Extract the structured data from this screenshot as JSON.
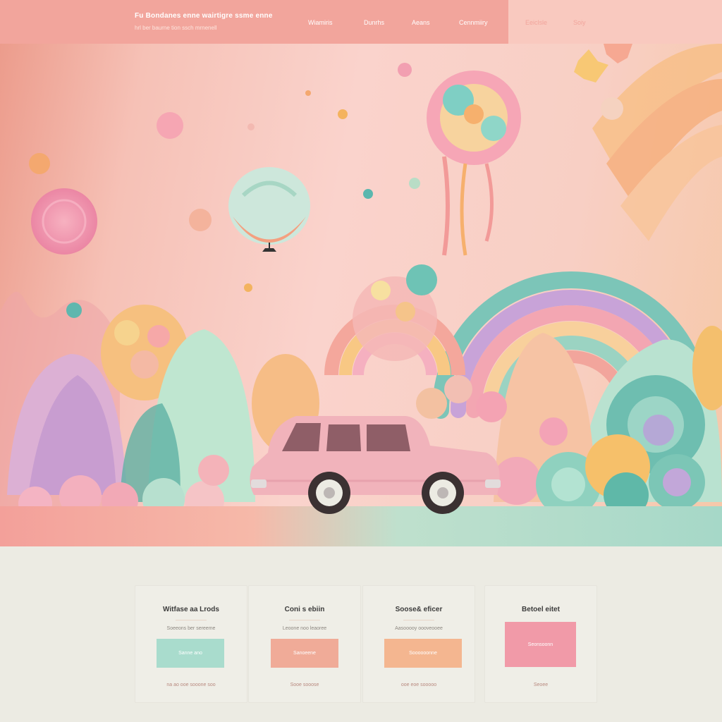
{
  "header": {
    "brand_title": "Fu Bondanes enne wairtigre ssme enne",
    "brand_subtitle": "hrl ber baurne tion ssch mrnenell",
    "nav": [
      "Wiamiris",
      "Dunrhs",
      "Aeans",
      "Cennmiiry"
    ],
    "nav_right": [
      "Eeiclsle",
      "Soiy"
    ],
    "colors": {
      "left": "#f2a59c",
      "right": "#f9c9bf"
    }
  },
  "hero": {
    "scene": "pastel candy landscape with pink car, rainbows, balloons"
  },
  "features": {
    "cards": [
      {
        "title": "Witfase aa Lrods",
        "subtitle": "Soeeons ber sereeme",
        "button": "Sanne ano",
        "footer": "na ao ooe sooone soo",
        "button_color": "#a9dccd"
      },
      {
        "title": "Coni s ebiin",
        "subtitle": "Leoone noo leaoree",
        "button": "Sanoeene",
        "footer": "Sooe sooose",
        "button_color": "#f0ab98"
      },
      {
        "title": "Soose& eficer",
        "subtitle": "Aasooooy oooveooee",
        "button": "Soooooonne",
        "footer": "ooe eoe sooooo",
        "button_color": "#f4b690"
      },
      {
        "title": "Betoel eitet",
        "subtitle": "",
        "button": "Seonsoonn",
        "footer": "Seoee",
        "button_color": "#f19aa8"
      }
    ]
  }
}
